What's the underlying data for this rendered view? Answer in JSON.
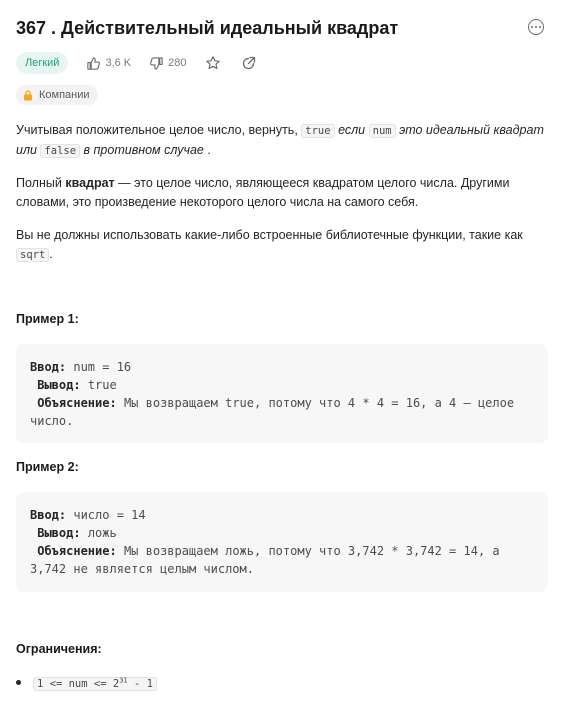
{
  "problem": {
    "title": "367 . Действительный идеальный квадрат",
    "difficulty": "Легкий",
    "likes": "3,6 K",
    "dislikes": "280",
    "companies_label": "Компании"
  },
  "description": {
    "p1_a": "Учитывая положительное целое число, вернуть,",
    "p1_code1": "true",
    "p1_b": "если",
    "p1_code2": "num",
    "p1_c": "это идеальный квадрат",
    "p1_d": "или",
    "p1_code3": "false",
    "p1_e": "в противном случае",
    "p1_f": ".",
    "p2_a": "Полный",
    "p2_bold": "квадрат",
    "p2_b": "— это целое число, являющееся квадратом целого числа. Другими словами, это произведение некоторого целого числа на самого себя.",
    "p3_a": "Вы не должны использовать какие-либо встроенные библиотечные функции, такие как",
    "p3_code": "sqrt",
    "p3_b": "."
  },
  "examples": [
    {
      "title": "Пример 1:",
      "input_label": "Ввод:",
      "input_value": "num = 16",
      "output_label": "Вывод:",
      "output_value": "true",
      "explanation_label": "Объяснение:",
      "explanation_value": "Мы возвращаем true, потому что 4 * 4 = 16, а 4 — целое число."
    },
    {
      "title": "Пример 2:",
      "input_label": "Ввод:",
      "input_value": "число = 14",
      "output_label": "Вывод:",
      "output_value": "ложь",
      "explanation_label": "Объяснение:",
      "explanation_value": "Мы возвращаем ложь, потому что 3,742 * 3,742 = 14, а 3,742 не является целым числом."
    }
  ],
  "constraints": {
    "title": "Ограничения:",
    "item_base": "1 <= num <= 2",
    "item_exp": "31",
    "item_tail": " - 1"
  },
  "colors": {
    "easy_text": "#1ea36f",
    "easy_bg": "#e8f6f1",
    "companies_lock": "#f5a623"
  }
}
